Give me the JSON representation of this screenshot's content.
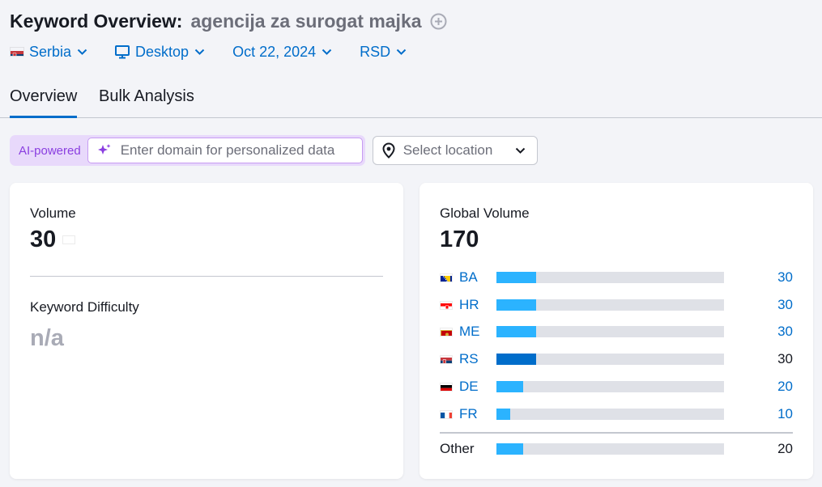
{
  "header": {
    "title": "Keyword Overview:",
    "keyword": "agencija za surogat majka"
  },
  "filters": {
    "country": "Serbia",
    "device": "Desktop",
    "date": "Oct 22, 2024",
    "currency": "RSD"
  },
  "tabs": [
    {
      "label": "Overview",
      "active": true
    },
    {
      "label": "Bulk Analysis",
      "active": false
    }
  ],
  "ai": {
    "badge": "AI-powered",
    "placeholder": "Enter domain for personalized data",
    "value": ""
  },
  "location": {
    "placeholder": "Select location"
  },
  "volume": {
    "label": "Volume",
    "value": "30"
  },
  "difficulty": {
    "label": "Keyword Difficulty",
    "value": "n/a"
  },
  "global": {
    "label": "Global Volume",
    "value": "170",
    "max": 170,
    "countries": [
      {
        "code": "BA",
        "value": "30",
        "fraction": 0.176,
        "link": true
      },
      {
        "code": "HR",
        "value": "30",
        "fraction": 0.176,
        "link": true
      },
      {
        "code": "ME",
        "value": "30",
        "fraction": 0.176,
        "link": true
      },
      {
        "code": "RS",
        "value": "30",
        "fraction": 0.176,
        "link": false,
        "highlight": true
      },
      {
        "code": "DE",
        "value": "20",
        "fraction": 0.118,
        "link": true
      },
      {
        "code": "FR",
        "value": "10",
        "fraction": 0.059,
        "link": true
      }
    ],
    "other": {
      "label": "Other",
      "value": "20",
      "fraction": 0.118
    }
  },
  "colors": {
    "link": "#006dca",
    "bar": "#2bb3ff",
    "bar_highlight": "#006dca",
    "ai_accent": "#8a3ee0"
  }
}
